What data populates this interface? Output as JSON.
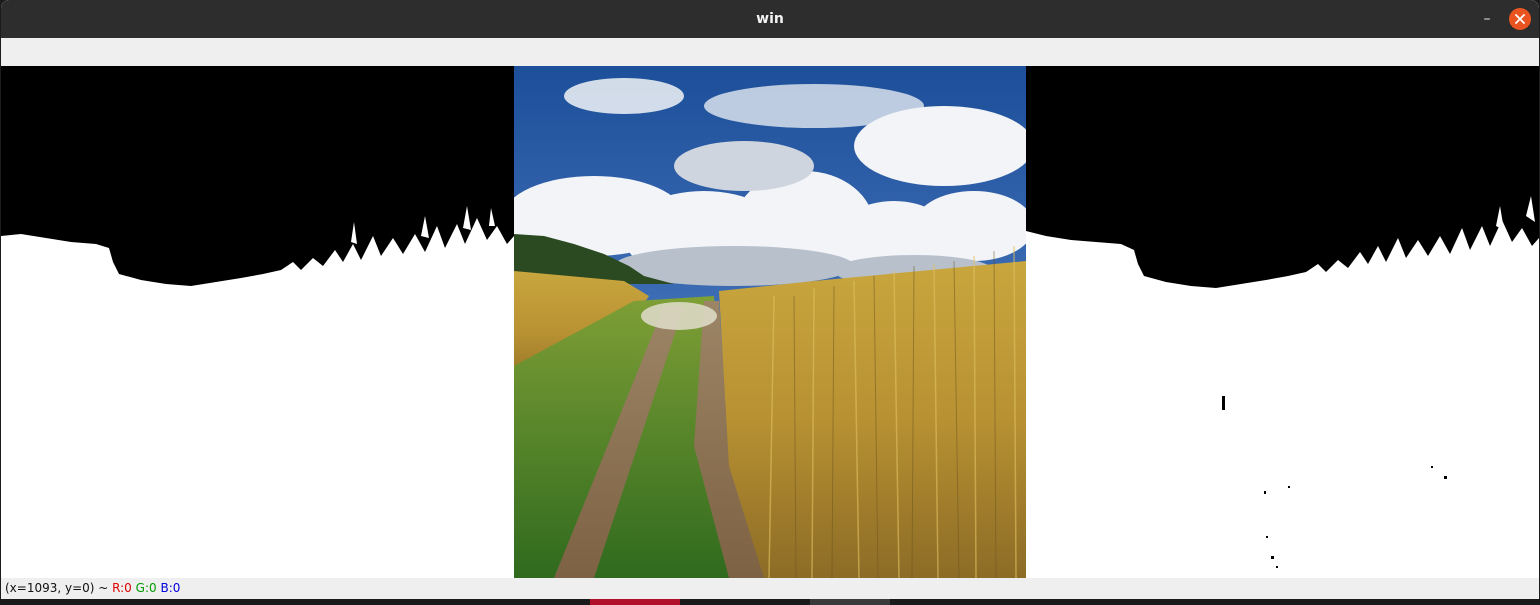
{
  "window": {
    "title": "win"
  },
  "status": {
    "coords": "(x=1093, y=0) ~ ",
    "r_label": "R:0",
    "g_label": "G:0",
    "b_label": "B:0"
  },
  "colors": {
    "titlebar": "#2d2d2d",
    "close_button": "#e95420",
    "red_text": "#e00000",
    "green_text": "#009900",
    "blue_text": "#0000dd"
  },
  "icons": {
    "minimize": "minimize-icon",
    "close": "close-icon"
  },
  "panels": [
    {
      "name": "left-mask",
      "kind": "binary mask (black sky, white ground)"
    },
    {
      "name": "center-photo",
      "kind": "landscape photo: clouds, wheat field, dirt road"
    },
    {
      "name": "right-mask",
      "kind": "binary mask (black sky, white ground)"
    }
  ]
}
